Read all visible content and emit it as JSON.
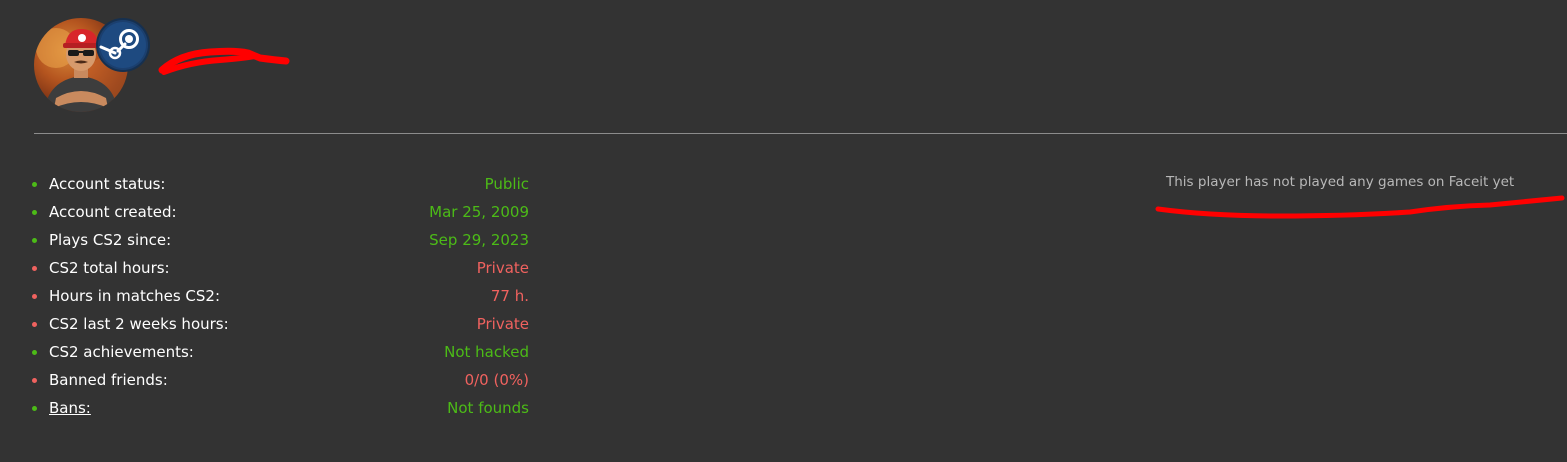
{
  "profile": {
    "avatar_icon": "user-avatar",
    "steam_icon": "steam-logo-icon",
    "name_redaction_color": "#ff0000"
  },
  "stats": [
    {
      "label": "Account status:",
      "value": "Public",
      "status": "good"
    },
    {
      "label": "Account created:",
      "value": "Mar 25, 2009",
      "status": "good"
    },
    {
      "label": "Plays CS2 since:",
      "value": "Sep 29, 2023",
      "status": "good"
    },
    {
      "label": "CS2 total hours:",
      "value": "Private",
      "status": "bad"
    },
    {
      "label": "Hours in matches CS2:",
      "value": "77 h.",
      "status": "bad"
    },
    {
      "label": "CS2 last 2 weeks hours:",
      "value": "Private",
      "status": "bad"
    },
    {
      "label": "CS2 achievements:",
      "value": "Not hacked",
      "status": "good"
    },
    {
      "label": "Banned friends:",
      "value": "0/0 (0%)",
      "status": "bad"
    },
    {
      "label": "Bans:",
      "value": "Not founds",
      "status": "good",
      "link": true
    }
  ],
  "faceit": {
    "message": "This player has not played any games on Faceit yet"
  },
  "colors": {
    "background": "#333333",
    "good": "#4cbb17",
    "bad": "#f0625f",
    "label": "#ffffff",
    "muted": "#b8b8b8",
    "redaction": "#ff0000"
  }
}
